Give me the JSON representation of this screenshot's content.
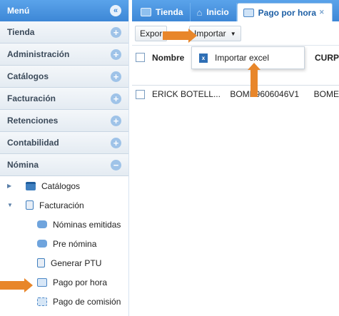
{
  "sidebar": {
    "title": "Menú",
    "sections": [
      {
        "label": "Tienda"
      },
      {
        "label": "Administración"
      },
      {
        "label": "Catálogos"
      },
      {
        "label": "Facturación"
      },
      {
        "label": "Retenciones"
      },
      {
        "label": "Contabilidad"
      },
      {
        "label": "Nómina"
      }
    ],
    "tree": {
      "catalogos": "Catálogos",
      "facturacion": "Facturación",
      "nominas_emitidas": "Nóminas emitidas",
      "pre_nomina": "Pre nómina",
      "generar_ptu": "Generar PTU",
      "pago_por_hora": "Pago por hora",
      "pago_comision": "Pago de comisión"
    }
  },
  "tabs": [
    {
      "label": "Tienda"
    },
    {
      "label": "Inicio"
    },
    {
      "label": "Pago por hora"
    }
  ],
  "toolbar": {
    "exportar": "Expor",
    "importar": "Importar"
  },
  "dropdown": {
    "importar_excel": "Importar excel"
  },
  "grid": {
    "columns": [
      "Nombre",
      "CURP"
    ],
    "rows": [
      {
        "nombre": "ERICK BOTELL...",
        "rfc": "BOME9606046V1",
        "curp": "BOME"
      }
    ]
  },
  "colors": {
    "header_blue": "#3d87d6",
    "annotation_orange": "#e8862a"
  }
}
